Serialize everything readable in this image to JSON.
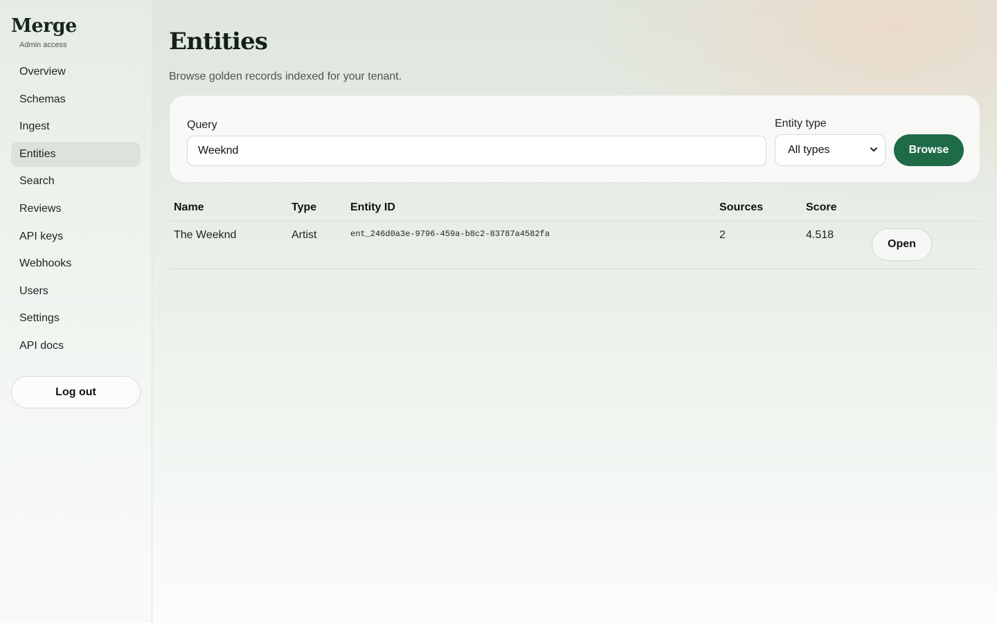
{
  "sidebar": {
    "brand": "Merge",
    "subtitle": "Admin access",
    "items": [
      {
        "label": "Overview"
      },
      {
        "label": "Schemas"
      },
      {
        "label": "Ingest"
      },
      {
        "label": "Entities",
        "active": true
      },
      {
        "label": "Search"
      },
      {
        "label": "Reviews"
      },
      {
        "label": "API keys"
      },
      {
        "label": "Webhooks"
      },
      {
        "label": "Users"
      },
      {
        "label": "Settings"
      },
      {
        "label": "API docs"
      }
    ],
    "logout_label": "Log out"
  },
  "main": {
    "title": "Entities",
    "subtitle": "Browse golden records indexed for your tenant.",
    "filters": {
      "query_label": "Query",
      "query_value": "Weeknd",
      "type_label": "Entity type",
      "type_value": "All types",
      "browse_label": "Browse"
    },
    "table": {
      "headers": [
        "Name",
        "Type",
        "Entity ID",
        "Sources",
        "Score",
        ""
      ],
      "rows": [
        {
          "name": "The Weeknd",
          "type": "Artist",
          "entity_id": "ent_246d0a3e-9796-459a-b8c2-83787a4582fa",
          "sources": "2",
          "score": "4.518",
          "action": "Open"
        }
      ]
    }
  },
  "colors": {
    "accent": "#1f6b47",
    "active_nav_bg": "#dbe3db"
  }
}
